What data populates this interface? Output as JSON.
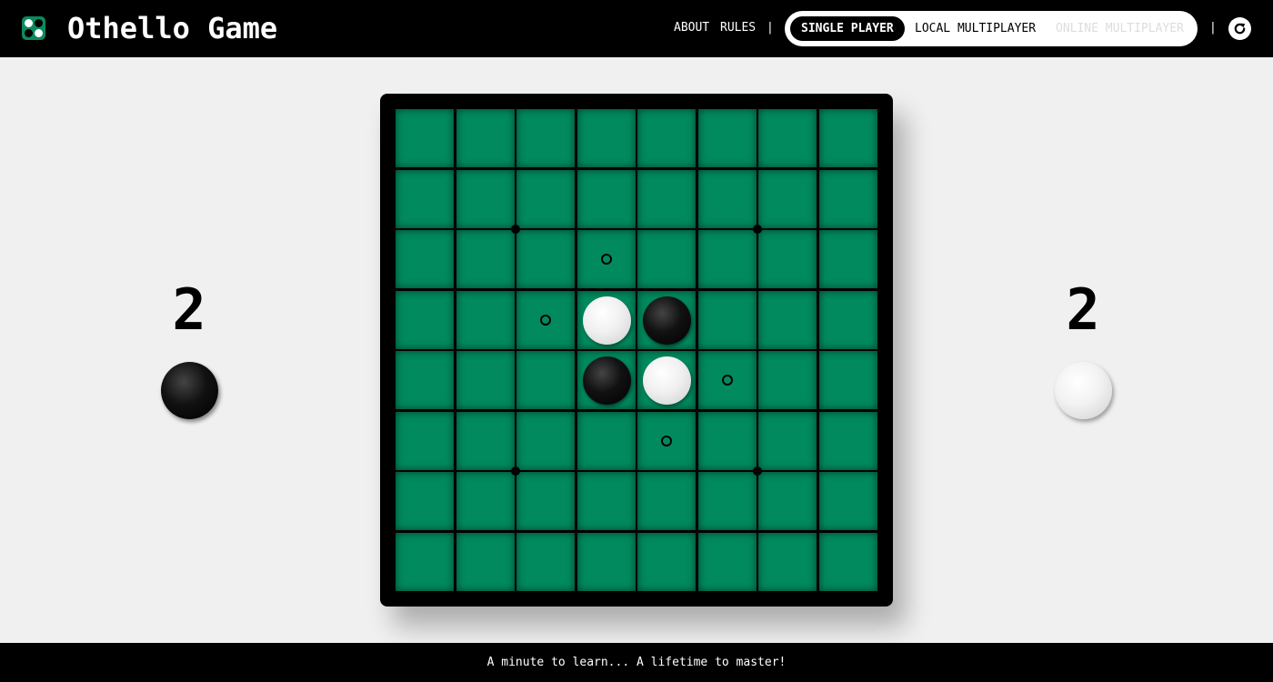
{
  "header": {
    "title": "Othello Game",
    "logo_icon": "othello-logo-icon",
    "nav": {
      "about": "ABOUT",
      "rules": "RULES",
      "separator": "|"
    },
    "modes": {
      "single": "SINGLE PLAYER",
      "local": "LOCAL MULTIPLAYER",
      "online": "ONLINE MULTIPLAYER",
      "selected": "single",
      "online_disabled": true
    },
    "restart_icon": "restart-icon"
  },
  "scores": {
    "black": "2",
    "white": "2"
  },
  "board": {
    "size": 8,
    "cells": [
      [
        "",
        "",
        "",
        "",
        "",
        "",
        "",
        ""
      ],
      [
        "",
        "",
        "",
        "",
        "",
        "",
        "",
        ""
      ],
      [
        "",
        "",
        "",
        "hint",
        "",
        "",
        "",
        ""
      ],
      [
        "",
        "",
        "hint",
        "white",
        "black",
        "",
        "",
        ""
      ],
      [
        "",
        "",
        "",
        "black",
        "white",
        "hint",
        "",
        ""
      ],
      [
        "",
        "",
        "",
        "",
        "hint",
        "",
        "",
        ""
      ],
      [
        "",
        "",
        "",
        "",
        "",
        "",
        "",
        ""
      ],
      [
        "",
        "",
        "",
        "",
        "",
        "",
        "",
        ""
      ]
    ],
    "star_points": [
      [
        2,
        2
      ],
      [
        2,
        6
      ],
      [
        6,
        2
      ],
      [
        6,
        6
      ]
    ]
  },
  "footer": {
    "tagline": "A minute to learn... A lifetime to master!"
  },
  "colors": {
    "board_green": "#008a5e",
    "board_frame": "#000000",
    "header_bg": "#000000",
    "page_bg": "#f0f0f0"
  }
}
